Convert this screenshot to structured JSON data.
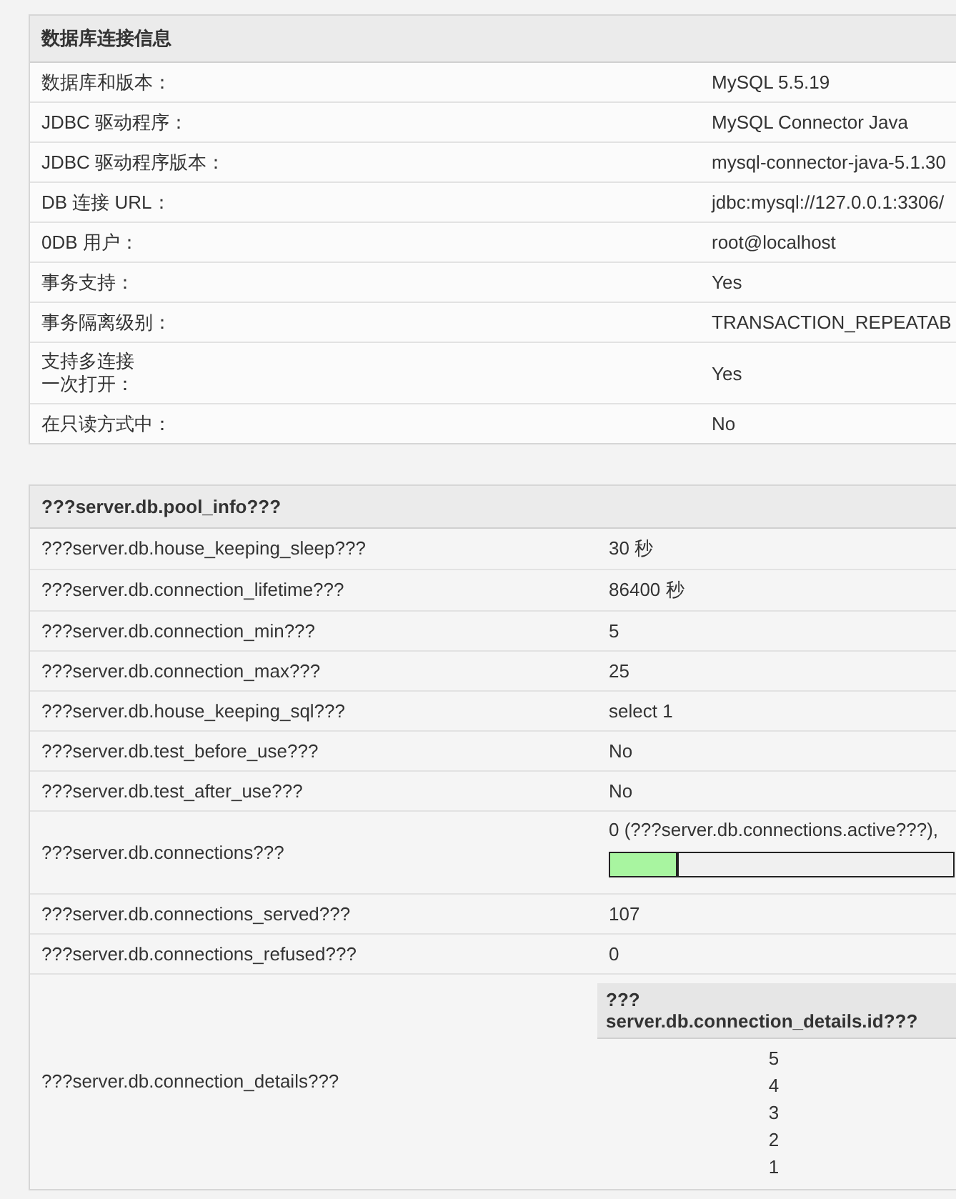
{
  "sections": [
    {
      "title": "数据库连接信息",
      "rows": [
        {
          "kind": "text",
          "label": "数据库和版本：",
          "value": "MySQL 5.5.19"
        },
        {
          "kind": "text",
          "label": "JDBC 驱动程序：",
          "value": "MySQL Connector Java"
        },
        {
          "kind": "text",
          "label": "JDBC 驱动程序版本：",
          "value": "mysql-connector-java-5.1.30"
        },
        {
          "kind": "text",
          "label": "DB 连接 URL：",
          "value": "jdbc:mysql://127.0.0.1:3306/"
        },
        {
          "kind": "text",
          "label": "0DB 用户：",
          "value": "root@localhost"
        },
        {
          "kind": "text",
          "label": "事务支持：",
          "value": "Yes"
        },
        {
          "kind": "text",
          "label": "事务隔离级别：",
          "value": "TRANSACTION_REPEATAB"
        },
        {
          "kind": "text",
          "label_lines": [
            "支持多连接",
            "一次打开："
          ],
          "value": "Yes"
        },
        {
          "kind": "text",
          "label": "在只读方式中：",
          "value": "No"
        }
      ]
    },
    {
      "title": "???server.db.pool_info???",
      "rows": [
        {
          "kind": "text",
          "label": "???server.db.house_keeping_sleep???",
          "value": "30 秒"
        },
        {
          "kind": "text",
          "label": "???server.db.connection_lifetime???",
          "value": "86400 秒"
        },
        {
          "kind": "text",
          "label": "???server.db.connection_min???",
          "value": "5"
        },
        {
          "kind": "text",
          "label": "???server.db.connection_max???",
          "value": "25"
        },
        {
          "kind": "text",
          "label": "???server.db.house_keeping_sql???",
          "value": "select 1"
        },
        {
          "kind": "text",
          "label": "???server.db.test_before_use???",
          "value": "No"
        },
        {
          "kind": "text",
          "label": "???server.db.test_after_use???",
          "value": "No"
        },
        {
          "kind": "meter",
          "label": "???server.db.connections???",
          "value": "0 (???server.db.connections.active???),",
          "level": 0.2
        },
        {
          "kind": "text",
          "label": "???server.db.connections_served???",
          "value": "107"
        },
        {
          "kind": "text",
          "label": "???server.db.connections_refused???",
          "value": "0"
        },
        {
          "kind": "details",
          "label": "???server.db.connection_details???",
          "header": "???\nserver.db.connection_details.id???",
          "ids": [
            "5",
            "4",
            "3",
            "2",
            "1"
          ]
        }
      ]
    }
  ]
}
